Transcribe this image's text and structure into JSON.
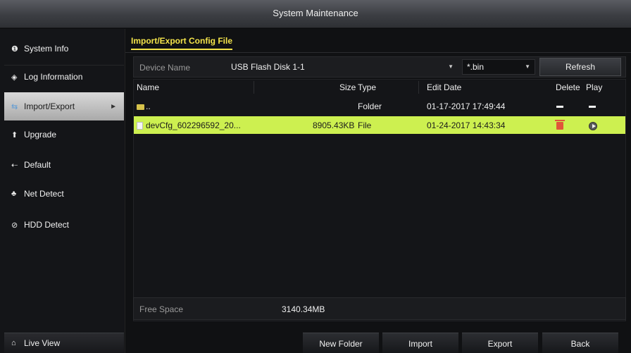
{
  "window": {
    "title": "System Maintenance"
  },
  "sidebar": {
    "items": [
      {
        "label": "System Info",
        "icon": "info-icon",
        "glyph": "❶"
      },
      {
        "label": "Log Information",
        "icon": "log-icon",
        "glyph": "◈"
      },
      {
        "label": "Import/Export",
        "icon": "import-export-icon",
        "glyph": "⇆",
        "active": true
      },
      {
        "label": "Upgrade",
        "icon": "upgrade-icon",
        "glyph": "⬆"
      },
      {
        "label": "Default",
        "icon": "default-icon",
        "glyph": "⇠"
      },
      {
        "label": "Net Detect",
        "icon": "net-detect-icon",
        "glyph": "♣"
      },
      {
        "label": "HDD Detect",
        "icon": "hdd-detect-icon",
        "glyph": "⊘"
      }
    ],
    "live_view": {
      "label": "Live View",
      "glyph": "⌂"
    }
  },
  "main": {
    "tab": "Import/Export Config File",
    "device": {
      "label": "Device Name",
      "selected": "USB Flash Disk 1-1",
      "ext_filter": "*.bin",
      "refresh_label": "Refresh"
    },
    "table": {
      "columns": {
        "name": "Name",
        "size": "Size",
        "type": "Type",
        "edit_date": "Edit Date",
        "delete": "Delete",
        "play": "Play"
      },
      "rows": [
        {
          "name": "..",
          "size": "",
          "type": "Folder",
          "edit_date": "01-17-2017 17:49:44",
          "kind": "folder"
        },
        {
          "name": "devCfg_602296592_20...",
          "size": "8905.43KB",
          "type": "File",
          "edit_date": "01-24-2017 14:43:34",
          "kind": "file",
          "selected": true
        }
      ]
    },
    "free_space": {
      "label": "Free Space",
      "value": "3140.34MB"
    }
  },
  "buttons": {
    "new_folder": "New Folder",
    "import": "Import",
    "export": "Export",
    "back": "Back"
  },
  "colors": {
    "accent": "#f4e44a",
    "selected_row": "#cdf050",
    "delete": "#e0553a"
  }
}
